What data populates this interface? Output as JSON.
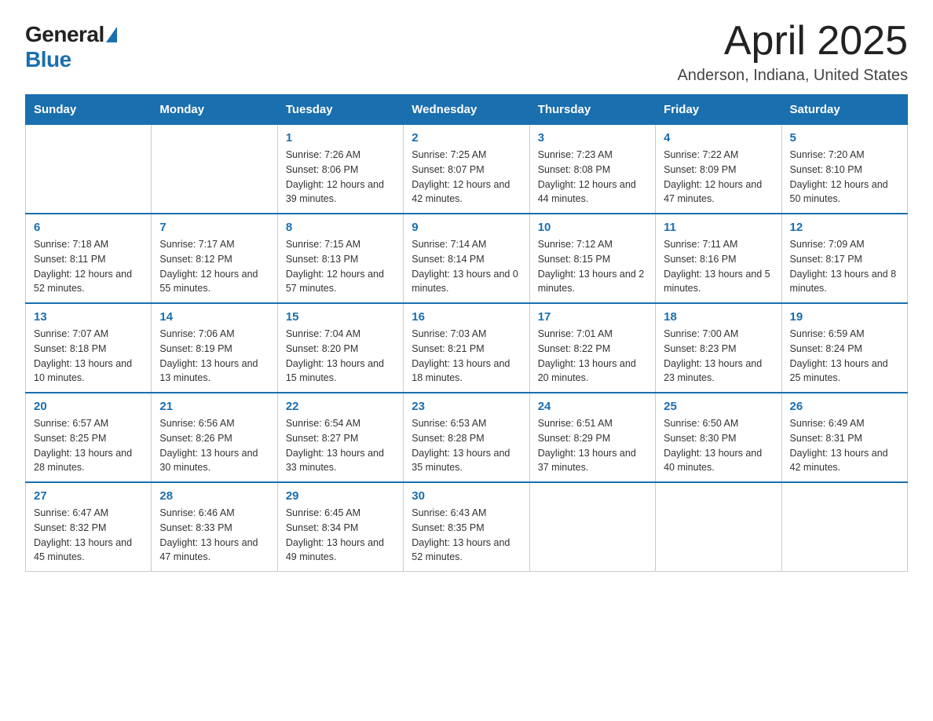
{
  "header": {
    "logo_general": "General",
    "logo_blue": "Blue",
    "title": "April 2025",
    "location": "Anderson, Indiana, United States"
  },
  "weekdays": [
    "Sunday",
    "Monday",
    "Tuesday",
    "Wednesday",
    "Thursday",
    "Friday",
    "Saturday"
  ],
  "weeks": [
    [
      {
        "day": "",
        "info": ""
      },
      {
        "day": "",
        "info": ""
      },
      {
        "day": "1",
        "info": "Sunrise: 7:26 AM\nSunset: 8:06 PM\nDaylight: 12 hours\nand 39 minutes."
      },
      {
        "day": "2",
        "info": "Sunrise: 7:25 AM\nSunset: 8:07 PM\nDaylight: 12 hours\nand 42 minutes."
      },
      {
        "day": "3",
        "info": "Sunrise: 7:23 AM\nSunset: 8:08 PM\nDaylight: 12 hours\nand 44 minutes."
      },
      {
        "day": "4",
        "info": "Sunrise: 7:22 AM\nSunset: 8:09 PM\nDaylight: 12 hours\nand 47 minutes."
      },
      {
        "day": "5",
        "info": "Sunrise: 7:20 AM\nSunset: 8:10 PM\nDaylight: 12 hours\nand 50 minutes."
      }
    ],
    [
      {
        "day": "6",
        "info": "Sunrise: 7:18 AM\nSunset: 8:11 PM\nDaylight: 12 hours\nand 52 minutes."
      },
      {
        "day": "7",
        "info": "Sunrise: 7:17 AM\nSunset: 8:12 PM\nDaylight: 12 hours\nand 55 minutes."
      },
      {
        "day": "8",
        "info": "Sunrise: 7:15 AM\nSunset: 8:13 PM\nDaylight: 12 hours\nand 57 minutes."
      },
      {
        "day": "9",
        "info": "Sunrise: 7:14 AM\nSunset: 8:14 PM\nDaylight: 13 hours\nand 0 minutes."
      },
      {
        "day": "10",
        "info": "Sunrise: 7:12 AM\nSunset: 8:15 PM\nDaylight: 13 hours\nand 2 minutes."
      },
      {
        "day": "11",
        "info": "Sunrise: 7:11 AM\nSunset: 8:16 PM\nDaylight: 13 hours\nand 5 minutes."
      },
      {
        "day": "12",
        "info": "Sunrise: 7:09 AM\nSunset: 8:17 PM\nDaylight: 13 hours\nand 8 minutes."
      }
    ],
    [
      {
        "day": "13",
        "info": "Sunrise: 7:07 AM\nSunset: 8:18 PM\nDaylight: 13 hours\nand 10 minutes."
      },
      {
        "day": "14",
        "info": "Sunrise: 7:06 AM\nSunset: 8:19 PM\nDaylight: 13 hours\nand 13 minutes."
      },
      {
        "day": "15",
        "info": "Sunrise: 7:04 AM\nSunset: 8:20 PM\nDaylight: 13 hours\nand 15 minutes."
      },
      {
        "day": "16",
        "info": "Sunrise: 7:03 AM\nSunset: 8:21 PM\nDaylight: 13 hours\nand 18 minutes."
      },
      {
        "day": "17",
        "info": "Sunrise: 7:01 AM\nSunset: 8:22 PM\nDaylight: 13 hours\nand 20 minutes."
      },
      {
        "day": "18",
        "info": "Sunrise: 7:00 AM\nSunset: 8:23 PM\nDaylight: 13 hours\nand 23 minutes."
      },
      {
        "day": "19",
        "info": "Sunrise: 6:59 AM\nSunset: 8:24 PM\nDaylight: 13 hours\nand 25 minutes."
      }
    ],
    [
      {
        "day": "20",
        "info": "Sunrise: 6:57 AM\nSunset: 8:25 PM\nDaylight: 13 hours\nand 28 minutes."
      },
      {
        "day": "21",
        "info": "Sunrise: 6:56 AM\nSunset: 8:26 PM\nDaylight: 13 hours\nand 30 minutes."
      },
      {
        "day": "22",
        "info": "Sunrise: 6:54 AM\nSunset: 8:27 PM\nDaylight: 13 hours\nand 33 minutes."
      },
      {
        "day": "23",
        "info": "Sunrise: 6:53 AM\nSunset: 8:28 PM\nDaylight: 13 hours\nand 35 minutes."
      },
      {
        "day": "24",
        "info": "Sunrise: 6:51 AM\nSunset: 8:29 PM\nDaylight: 13 hours\nand 37 minutes."
      },
      {
        "day": "25",
        "info": "Sunrise: 6:50 AM\nSunset: 8:30 PM\nDaylight: 13 hours\nand 40 minutes."
      },
      {
        "day": "26",
        "info": "Sunrise: 6:49 AM\nSunset: 8:31 PM\nDaylight: 13 hours\nand 42 minutes."
      }
    ],
    [
      {
        "day": "27",
        "info": "Sunrise: 6:47 AM\nSunset: 8:32 PM\nDaylight: 13 hours\nand 45 minutes."
      },
      {
        "day": "28",
        "info": "Sunrise: 6:46 AM\nSunset: 8:33 PM\nDaylight: 13 hours\nand 47 minutes."
      },
      {
        "day": "29",
        "info": "Sunrise: 6:45 AM\nSunset: 8:34 PM\nDaylight: 13 hours\nand 49 minutes."
      },
      {
        "day": "30",
        "info": "Sunrise: 6:43 AM\nSunset: 8:35 PM\nDaylight: 13 hours\nand 52 minutes."
      },
      {
        "day": "",
        "info": ""
      },
      {
        "day": "",
        "info": ""
      },
      {
        "day": "",
        "info": ""
      }
    ]
  ]
}
